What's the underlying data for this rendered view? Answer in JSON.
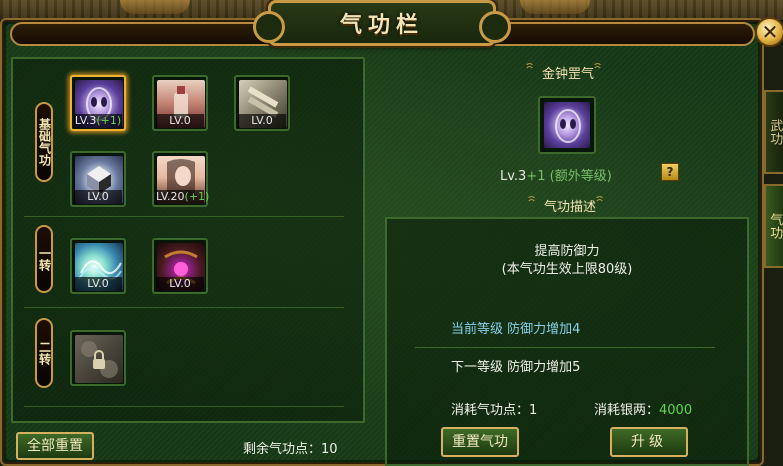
{
  "window": {
    "title": "气功栏",
    "close_symbol": "✕"
  },
  "side_tabs": [
    {
      "label": "武功"
    },
    {
      "label": "气功"
    }
  ],
  "categories": [
    {
      "label": "基础气功"
    },
    {
      "label": "一转"
    },
    {
      "label": "二转"
    }
  ],
  "skills": [
    {
      "icon": "purple-mask-icon",
      "level": "LV.3",
      "bonus": "(+1)",
      "selected": true
    },
    {
      "icon": "bottle-icon",
      "level": "LV.0",
      "bonus": ""
    },
    {
      "icon": "scroll-icon",
      "level": "LV.0",
      "bonus": ""
    },
    {
      "icon": "cube-icon",
      "level": "LV.0",
      "bonus": ""
    },
    {
      "icon": "woman-portrait-icon",
      "level": "LV.20",
      "bonus": "(+1)"
    },
    {
      "icon": "energy-wave-icon",
      "level": "LV.0",
      "bonus": ""
    },
    {
      "icon": "amulet-icon",
      "level": "LV.0",
      "bonus": ""
    },
    {
      "icon": "locked-skill-icon",
      "level": "",
      "bonus": "",
      "locked": true
    }
  ],
  "footer": {
    "reset_all_label": "全部重置",
    "remaining_points_label": "剩余气功点：10"
  },
  "detail": {
    "skill_name": "金钟罡气",
    "level_text": "Lv.3",
    "extra_text": "+1 (额外等级)",
    "help_symbol": "?",
    "desc_header": "气功描述",
    "desc_title": "提高防御力",
    "desc_sub": "(本气功生效上限80级)",
    "current_level": "当前等级  防御力增加4",
    "next_level": "下一等级  防御力增加5",
    "cost_points": "消耗气功点：1",
    "cost_silver_label": "消耗银两：",
    "cost_silver_value": "4000",
    "reset_skill_label": "重置气功",
    "upgrade_label": "升级"
  },
  "colors": {
    "frame_gold": "#c99a45",
    "panel_green": "#3d6a2c",
    "bonus_green": "#5fd84a",
    "current_level_blue": "#8ad0e8"
  }
}
